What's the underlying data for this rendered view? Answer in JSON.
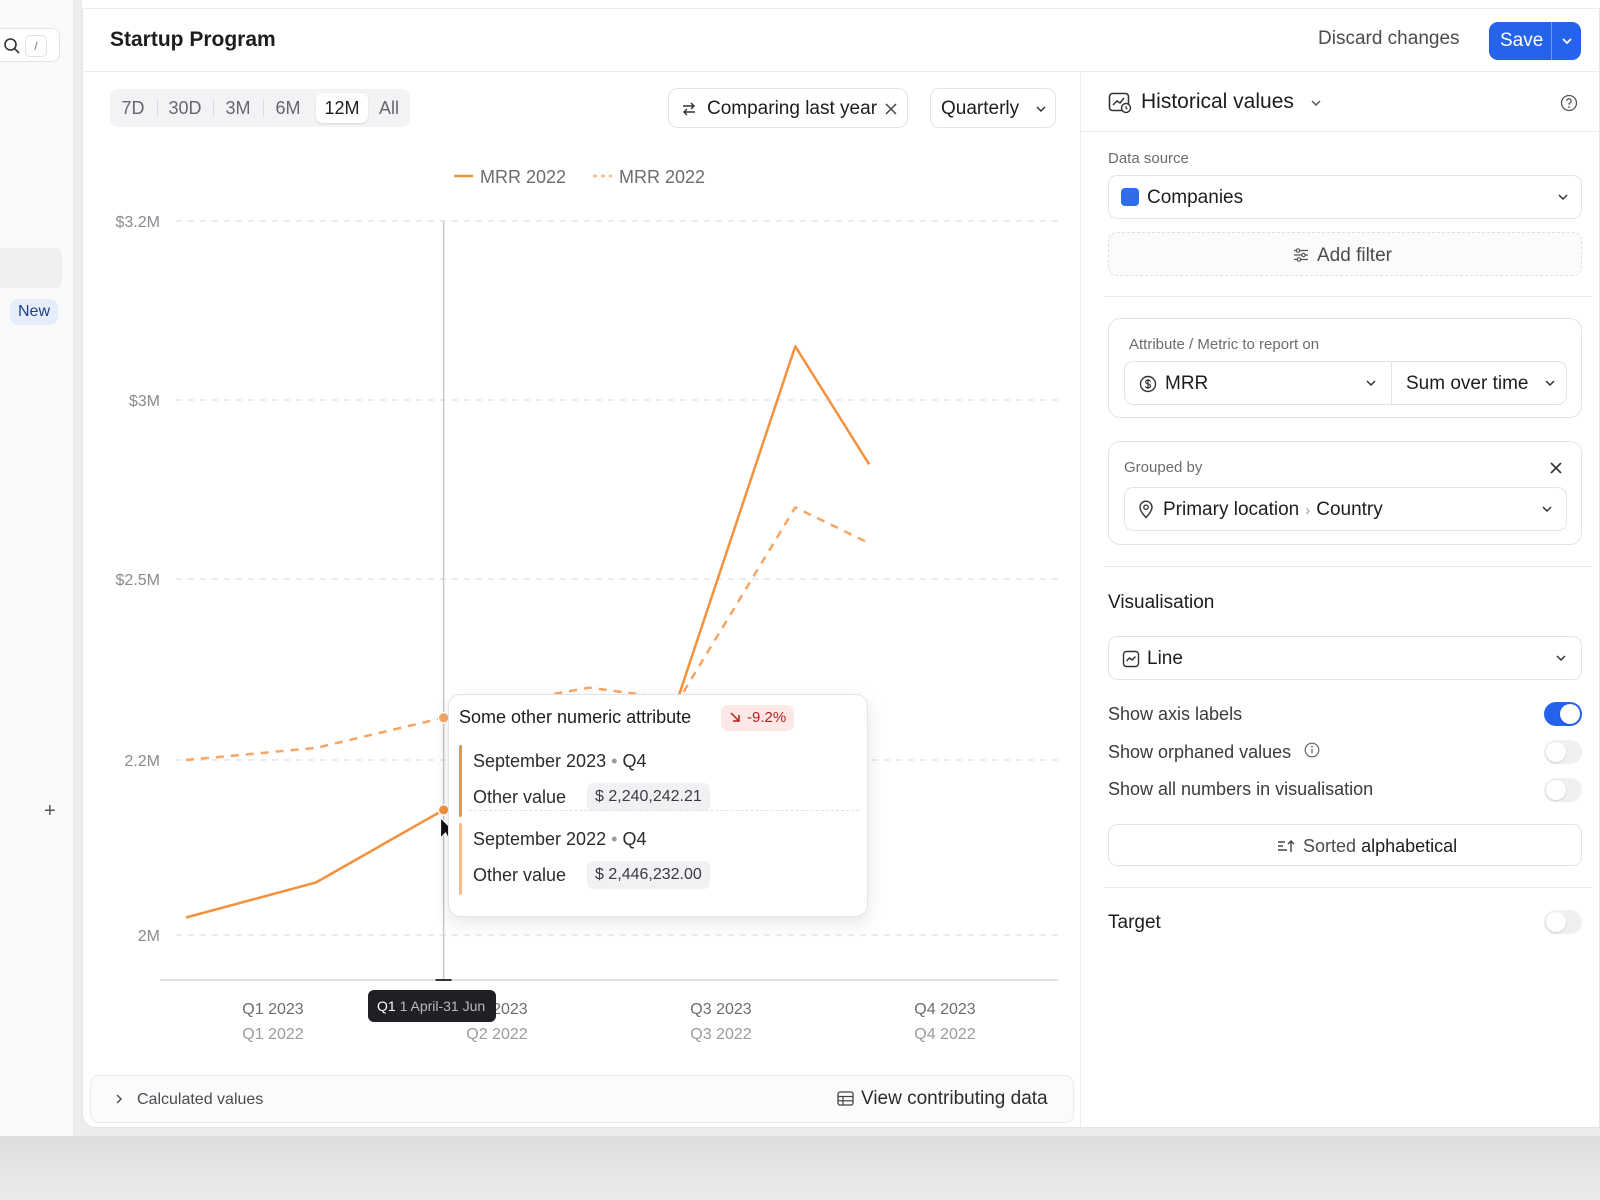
{
  "sidebar": {
    "search_shortcut": "/",
    "new_badge": "New",
    "add": "+"
  },
  "header": {
    "title": "Startup Program",
    "discard": "Discard changes",
    "save": "Save"
  },
  "toolbar": {
    "ranges": [
      "7D",
      "30D",
      "3M",
      "6M",
      "12M",
      "All"
    ],
    "active_range": "12M",
    "comparing": "Comparing last year",
    "interval": "Quarterly"
  },
  "colors": {
    "accent": "#2563eb",
    "series": "#f4913c"
  },
  "chart_data": {
    "type": "line",
    "legend": [
      "MRR 2022",
      "MRR 2022"
    ],
    "y_ticks": [
      {
        "value": 2.0,
        "label": "2M"
      },
      {
        "value": 2.2,
        "label": "2.2M"
      },
      {
        "value": 2.5,
        "label": "$2.5M"
      },
      {
        "value": 3.0,
        "label": "$3M"
      },
      {
        "value": 3.2,
        "label": "$3.2M"
      }
    ],
    "x_labels": [
      {
        "primary": "Q1 2023",
        "secondary": "Q1 2022"
      },
      {
        "primary": "Q2 2023",
        "secondary": "Q2 2022"
      },
      {
        "primary": "Q3 2023",
        "secondary": "Q3 2022"
      },
      {
        "primary": "Q4 2023",
        "secondary": "Q4 2022"
      }
    ],
    "series": [
      {
        "name": "MRR 2022",
        "style": "solid",
        "x": [
          0.0,
          0.58,
          1.15,
          1.5,
          2.0,
          2.72,
          3.05
        ],
        "y": [
          2.02,
          2.06,
          2.143,
          2.13,
          2.12,
          3.06,
          2.82
        ]
      },
      {
        "name": "MRR 2022",
        "style": "dashed",
        "x": [
          0.0,
          0.58,
          1.15,
          1.5,
          1.8,
          2.2,
          2.72,
          3.05
        ],
        "y": [
          2.2,
          2.22,
          2.27,
          2.3,
          2.32,
          2.3,
          2.7,
          2.6
        ]
      }
    ],
    "hover_index": 2,
    "grid": true
  },
  "tooltip": {
    "title": "Some other numeric attribute",
    "change": "-9.2%",
    "current": {
      "when": "September 2023",
      "quarter": "Q4",
      "label": "Other value",
      "value": "$ 2,240,242.21"
    },
    "previous": {
      "when": "September 2022",
      "quarter": "Q4",
      "label": "Other value",
      "value": "$ 2,446,232.00"
    }
  },
  "hover_chip": {
    "quarter": "Q1",
    "range": "1 April-31 Jun"
  },
  "bottom": {
    "calculated": "Calculated values",
    "view": "View contributing data"
  },
  "panel": {
    "title": "Historical values",
    "data_source_label": "Data source",
    "data_source": "Companies",
    "add_filter": "Add filter",
    "metric_label": "Attribute / Metric to report on",
    "metric": "MRR",
    "aggregation": "Sum over time",
    "grouped_label": "Grouped by",
    "group_path": "Primary location",
    "group_leaf": "Country",
    "visualisation_label": "Visualisation",
    "visualisation": "Line",
    "toggles": [
      {
        "label": "Show axis labels",
        "on": true
      },
      {
        "label": "Show orphaned values",
        "on": false
      },
      {
        "label": "Show all numbers in visualisation",
        "on": false
      }
    ],
    "sort_prefix": "Sorted",
    "sort_value": "alphabetical",
    "target_label": "Target",
    "target_on": false
  }
}
